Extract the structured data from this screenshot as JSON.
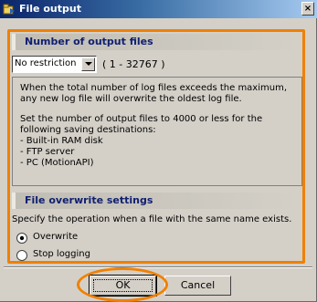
{
  "window": {
    "title": "File output",
    "close_glyph": "×"
  },
  "output_files": {
    "header": "Number of output files",
    "selected": "No restriction",
    "range": "( 1 - 32767 )",
    "info_paragraph_1": "When the total number of log files exceeds the maximum, any new log file will overwrite the oldest log file.",
    "info_paragraph_2": "Set the number of output files to 4000 or less for the following saving destinations:",
    "destinations": [
      "- Built-in RAM disk",
      "- FTP server",
      "- PC (MotionAPI)"
    ]
  },
  "overwrite": {
    "header": "File overwrite settings",
    "description": "Specify the operation when a file with the same name exists.",
    "options": [
      {
        "label": "Overwrite",
        "selected": true
      },
      {
        "label": "Stop logging",
        "selected": false
      }
    ]
  },
  "buttons": {
    "ok": "OK",
    "cancel": "Cancel"
  },
  "colors": {
    "highlight": "#f08000",
    "title_bar_start": "#0a246a",
    "title_bar_end": "#a6caf0",
    "window_bg": "#d4d0c8"
  }
}
